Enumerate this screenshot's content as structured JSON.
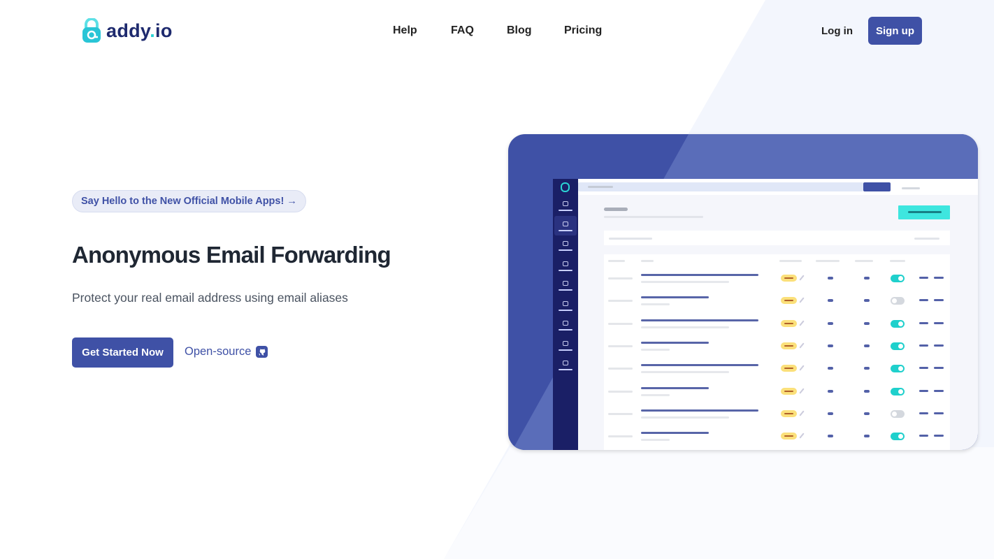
{
  "header": {
    "brand": "addy",
    "brand_suffix": "io",
    "nav": [
      "Help",
      "FAQ",
      "Blog",
      "Pricing"
    ],
    "login": "Log in",
    "signup": "Sign up"
  },
  "hero": {
    "badge": "Say Hello to the New Official Mobile Apps! →",
    "title": "Anonymous Email Forwarding",
    "subtitle": "Protect your real email address using email aliases",
    "cta": "Get Started Now",
    "open_source": "Open-source"
  },
  "colors": {
    "primary": "#3f51a6",
    "accent": "#2bd4d4",
    "sidebar": "#1a1f66"
  },
  "mockup": {
    "sidebar_icons": [
      "home-icon",
      "at-icon",
      "inbox-icon",
      "users-icon",
      "globe-icon",
      "filter-icon",
      "warning-icon",
      "gear-icon",
      "card-icon"
    ],
    "rows_toggle_on": [
      true,
      false,
      true,
      true,
      true,
      true,
      false,
      true
    ]
  }
}
